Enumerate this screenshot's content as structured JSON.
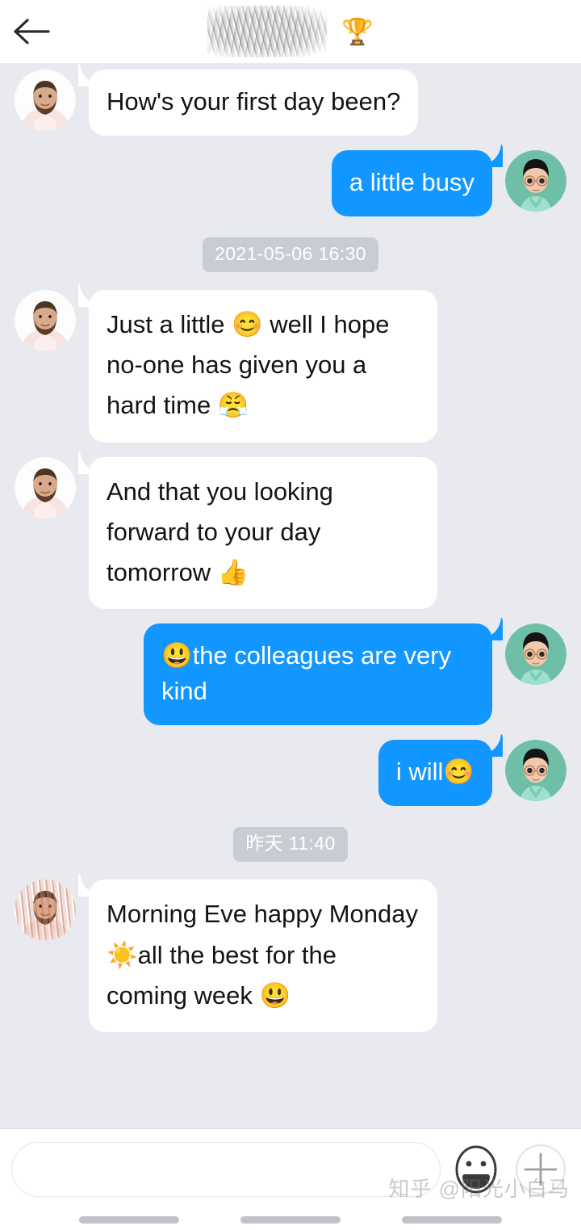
{
  "header": {
    "back_icon": "arrow-left-icon",
    "contact_name": "",
    "contact_name_redacted": true,
    "title_emoji": "🏆",
    "background": "#FFFFFF"
  },
  "theme": {
    "chat_background": "#E8EAEF",
    "incoming_bubble": "#FFFFFF",
    "incoming_text": "#141414",
    "outgoing_bubble": "#1296FF",
    "outgoing_text": "#FFFFFF",
    "timestamp_chip": "#C9CCD2",
    "timestamp_text": "#FFFFFF"
  },
  "conversation": [
    {
      "kind": "message",
      "direction": "incoming",
      "avatar": "contact-avatar-photo",
      "text": "How's your first day been?",
      "loose": false
    },
    {
      "kind": "message",
      "direction": "outgoing",
      "avatar": "user-avatar-cartoon",
      "text": "a little busy",
      "loose": false
    },
    {
      "kind": "timestamp",
      "text": "2021-05-06 16:30"
    },
    {
      "kind": "message",
      "direction": "incoming",
      "avatar": "contact-avatar-photo",
      "text": "Just a little 😊 well I hope no-one has given you a hard time 😤",
      "loose": true
    },
    {
      "kind": "message",
      "direction": "incoming",
      "avatar": "contact-avatar-photo",
      "text": "And that you looking forward to your day tomorrow 👍",
      "loose": true
    },
    {
      "kind": "message",
      "direction": "outgoing",
      "avatar": "user-avatar-cartoon",
      "text": "😃the colleagues are very kind",
      "loose": false
    },
    {
      "kind": "message",
      "direction": "outgoing",
      "avatar": "user-avatar-cartoon",
      "text": "i will😊",
      "loose": false
    },
    {
      "kind": "timestamp",
      "text": "昨天 11:40"
    },
    {
      "kind": "message",
      "direction": "incoming",
      "avatar": "contact-avatar-photo-redacted",
      "text": "Morning Eve happy Monday ☀️all the best for the coming week 😃",
      "loose": true
    }
  ],
  "input_bar": {
    "value": "",
    "placeholder": "",
    "emoji_button": "emoji-face-icon",
    "add_button": "plus-icon"
  },
  "watermark": {
    "text": "知乎 @阳光小白马"
  },
  "nav_bar": {
    "pills": 3
  }
}
